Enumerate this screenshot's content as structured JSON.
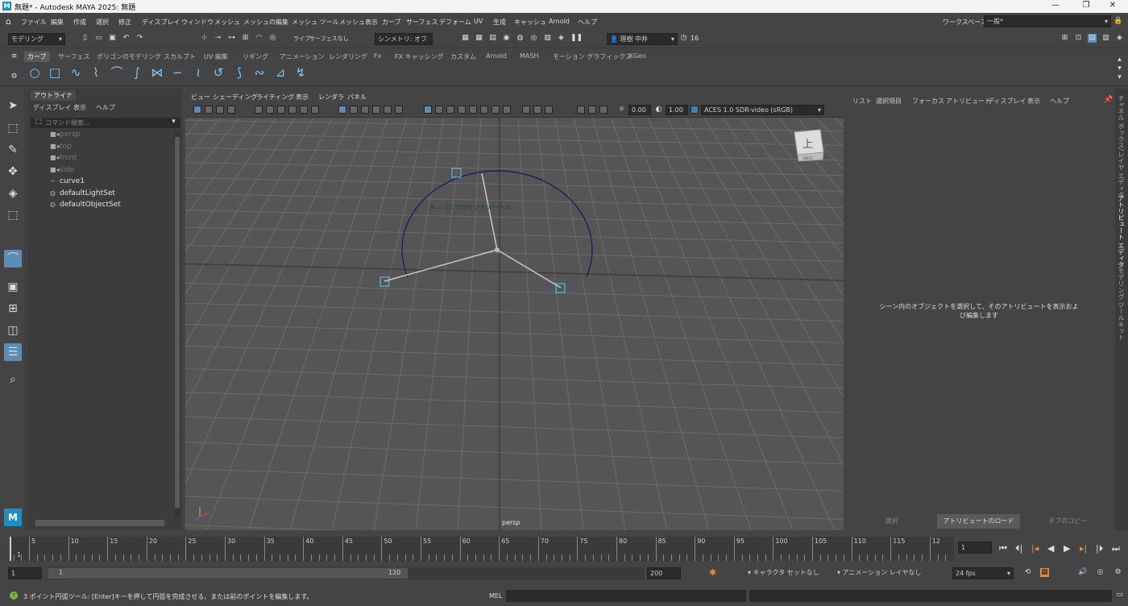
{
  "window": {
    "app_icon": "M",
    "title": "無題* - Autodesk MAYA 2025: 無題",
    "min": "—",
    "max": "❐",
    "close": "✕"
  },
  "menubar": {
    "items": [
      "ファイル",
      "編集",
      "作成",
      "選択",
      "修正",
      "ディスプレイ",
      "ウィンドウ",
      "メッシュ",
      "メッシュの編集",
      "メッシュ ツール",
      "メッシュ表示",
      "カーブ",
      "サーフェス",
      "デフォーム",
      "UV",
      "生成",
      "キャッシュ",
      "Arnold",
      "ヘルプ"
    ],
    "workspace_label": "ワークスペース :",
    "workspace_value": "一般*"
  },
  "statusline": {
    "mode": "モデリング",
    "live": "ライブ",
    "live_value": "サーフェスなし",
    "symmetry": "シンメトリ: オフ",
    "user": "理樹 中井",
    "credits": "16"
  },
  "shelf": {
    "tabs": [
      "カーブ",
      "サーフェス",
      "ポリゴンのモデリング",
      "スカルプト",
      "UV 編集",
      "リギング",
      "アニメーション",
      "レンダリング",
      "Fx",
      "FX キャッシング",
      "カスタム",
      "Arnold",
      "MASH",
      "モーション グラフィックス",
      "XGen"
    ],
    "active_tab": 0
  },
  "outliner": {
    "tab": "アウトライナ",
    "menu": [
      "ディスプレイ",
      "表示",
      "ヘルプ"
    ],
    "search_placeholder": "コマンド検索...",
    "rows": [
      {
        "label": "persp",
        "dim": true
      },
      {
        "label": "top",
        "dim": true
      },
      {
        "label": "front",
        "dim": true
      },
      {
        "label": "side",
        "dim": true
      },
      {
        "label": "curve1",
        "dim": false
      },
      {
        "label": "defaultLightSet",
        "dim": false
      },
      {
        "label": "defaultObjectSet",
        "dim": false
      }
    ]
  },
  "viewport": {
    "menu": [
      "ビュー",
      "シェーディング",
      "ライティング",
      "表示",
      "レンダラ",
      "パネル"
    ],
    "exposure": "0.00",
    "gamma": "1.00",
    "colorspace": "ACES 1.0 SDR-video (sRGB)",
    "camera_label": "persp",
    "radius_label": "R = 15.719センチメートル",
    "viewcube_label": "上",
    "viewcube_sub": "WEST"
  },
  "attribute_editor": {
    "menu": [
      "リスト",
      "選択項目",
      "フォーカス",
      "アトリビュート",
      "ディスプレイ",
      "表示",
      "ヘルプ"
    ],
    "message": "シーン内のオブジェクトを選択して、そのアトリビュートを表示および編集します",
    "buttons": [
      "選択",
      "アトリビュートのロード",
      "タブのコピー"
    ]
  },
  "side_tabs": [
    "チャネル ボックス/レイヤ エディタ",
    "アトリビュート エディタ",
    "モデリング ツールキット"
  ],
  "timeline": {
    "ticks": [
      "5",
      "10",
      "15",
      "20",
      "25",
      "30",
      "35",
      "40",
      "45",
      "50",
      "55",
      "60",
      "65",
      "70",
      "75",
      "80",
      "85",
      "90",
      "95",
      "100",
      "105",
      "110",
      "115",
      "12"
    ],
    "start_frame": "1",
    "current_frame": "1"
  },
  "range": {
    "start": "1",
    "inner_start": "1",
    "inner_end": "120",
    "end": "200",
    "character_set": "キャラクタ セットなし",
    "anim_layer": "アニメーション レイヤなし",
    "fps": "24 fps"
  },
  "statusbar": {
    "help": "3 ポイント円弧ツール: [Enter]キーを押して円弧を完成させる、または前のポイントを編集します。",
    "mel": "MEL"
  }
}
